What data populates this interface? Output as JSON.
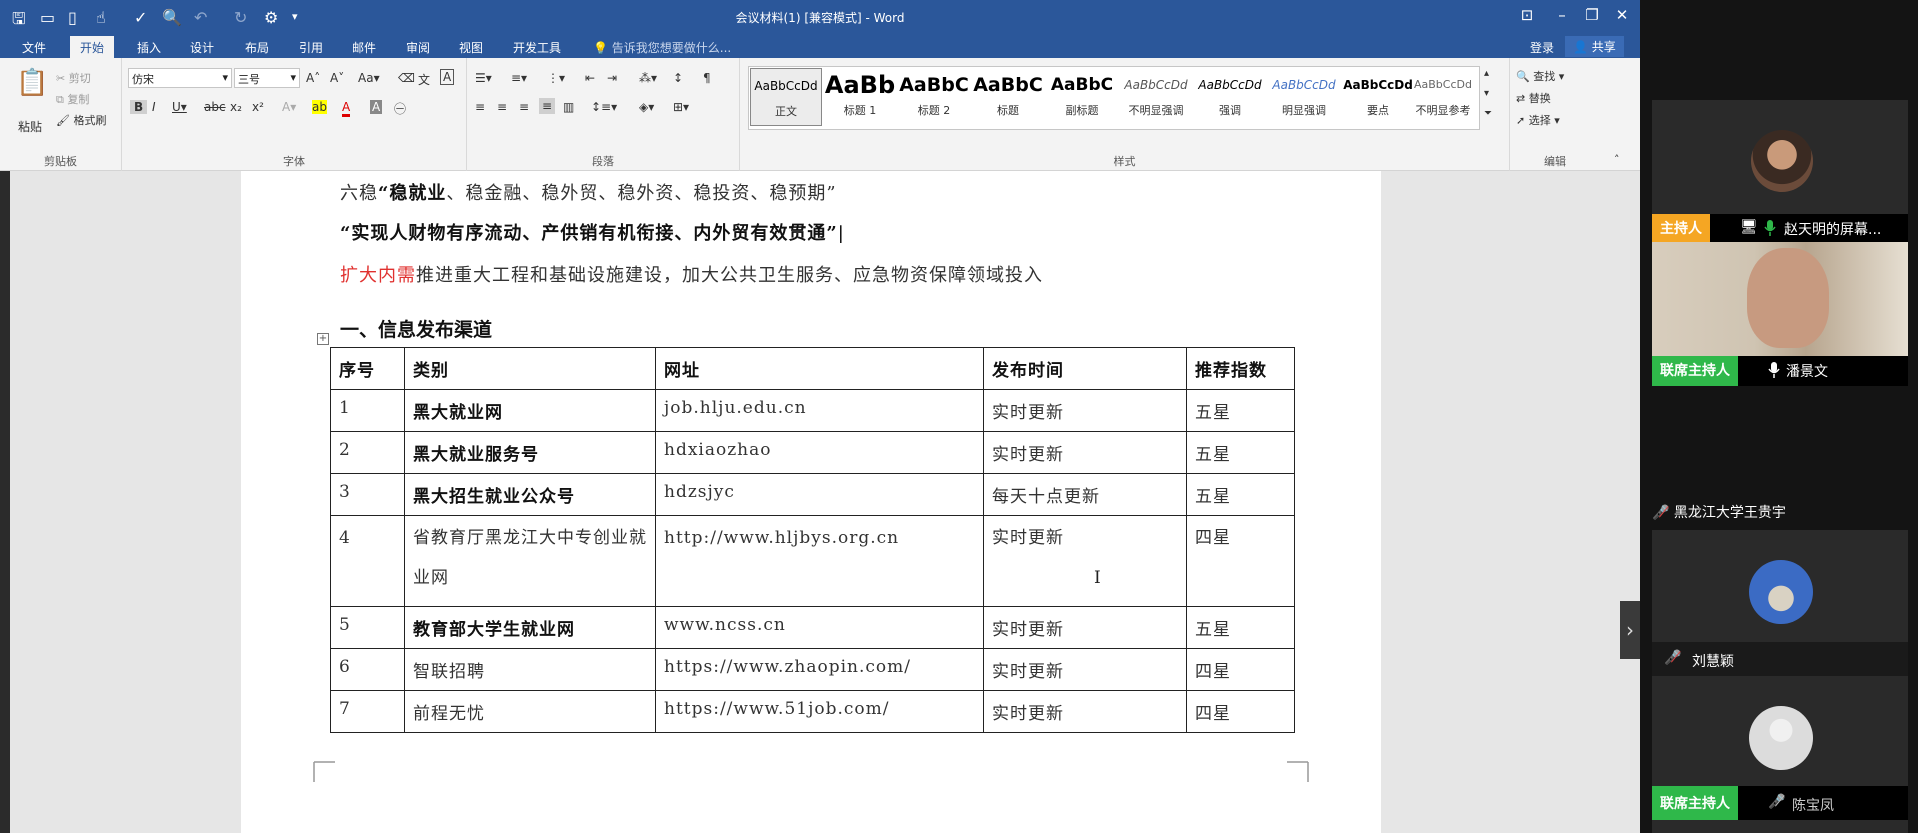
{
  "word": {
    "title": "会议材料(1) [兼容模式] - Word",
    "tabs": [
      "文件",
      "开始",
      "插入",
      "设计",
      "布局",
      "引用",
      "邮件",
      "审阅",
      "视图",
      "开发工具"
    ],
    "tell_me": "告诉我您想要做什么...",
    "login": "登录",
    "share": "共享",
    "clipboard": {
      "paste": "粘贴",
      "cut": "剪切",
      "copy": "复制",
      "format_painter": "格式刷",
      "group": "剪贴板"
    },
    "font": {
      "name": "仿宋",
      "size": "三号",
      "group": "字体"
    },
    "paragraph_group": "段落",
    "styles": {
      "group": "样式",
      "items": [
        {
          "preview": "AaBbCcDd",
          "name": "正文"
        },
        {
          "preview": "AaBb",
          "name": "标题 1"
        },
        {
          "preview": "AaBbC",
          "name": "标题 2"
        },
        {
          "preview": "AaBbC",
          "name": "标题"
        },
        {
          "preview": "AaBbC",
          "name": "副标题"
        },
        {
          "preview": "AaBbCcDd",
          "name": "不明显强调"
        },
        {
          "preview": "AaBbCcDd",
          "name": "强调"
        },
        {
          "preview": "AaBbCcDd",
          "name": "明显强调"
        },
        {
          "preview": "AaBbCcDd",
          "name": "要点"
        },
        {
          "preview": "AaBbCcDd",
          "name": "不明显参考"
        }
      ]
    },
    "editing": {
      "find": "查找",
      "replace": "替换",
      "select": "选择",
      "group": "编辑"
    }
  },
  "document": {
    "line1_prefix": "六稳",
    "line1_bold": "“稳就业",
    "line1_rest": "、稳金融、稳外贸、稳外资、稳投资、稳预期”",
    "line2": "“实现人财物有序流动、产供销有机衔接、内外贸有效贯通”",
    "line3_red": "扩大内需",
    "line3_rest": "推进重大工程和基础设施建设，加大公共卫生服务、应急物资保障领域投入",
    "heading": "一、信息发布渠道",
    "table": {
      "headers": [
        "序号",
        "类别",
        "网址",
        "发布时间",
        "推荐指数"
      ],
      "rows": [
        [
          "1",
          "黑大就业网",
          "job.hlju.edu.cn",
          "实时更新",
          "五星"
        ],
        [
          "2",
          "黑大就业服务号",
          "hdxiaozhao",
          "实时更新",
          "五星"
        ],
        [
          "3",
          "黑大招生就业公众号",
          "hdzsjyc",
          "每天十点更新",
          "五星"
        ],
        [
          "4",
          "省教育厅黑龙江大中专创业就业网",
          "http://www.hljbys.org.cn",
          "实时更新",
          "四星"
        ],
        [
          "5",
          "教育部大学生就业网",
          "www.ncss.cn",
          "实时更新",
          "五星"
        ],
        [
          "6",
          "智联招聘",
          "https://www.zhaopin.com/",
          "实时更新",
          "四星"
        ],
        [
          "7",
          "前程无忧",
          "https://www.51job.com/",
          "实时更新",
          "四星"
        ]
      ]
    }
  },
  "meeting": {
    "participants": [
      {
        "role": "主持人",
        "name": "赵天明的屏幕..."
      },
      {
        "role": "联席主持人",
        "name": "潘景文"
      },
      {
        "role": "",
        "name": "黑龙江大学王贵宇"
      },
      {
        "role": "",
        "name": "刘慧颖"
      },
      {
        "role": "联席主持人",
        "name": "陈宝凤"
      }
    ]
  }
}
